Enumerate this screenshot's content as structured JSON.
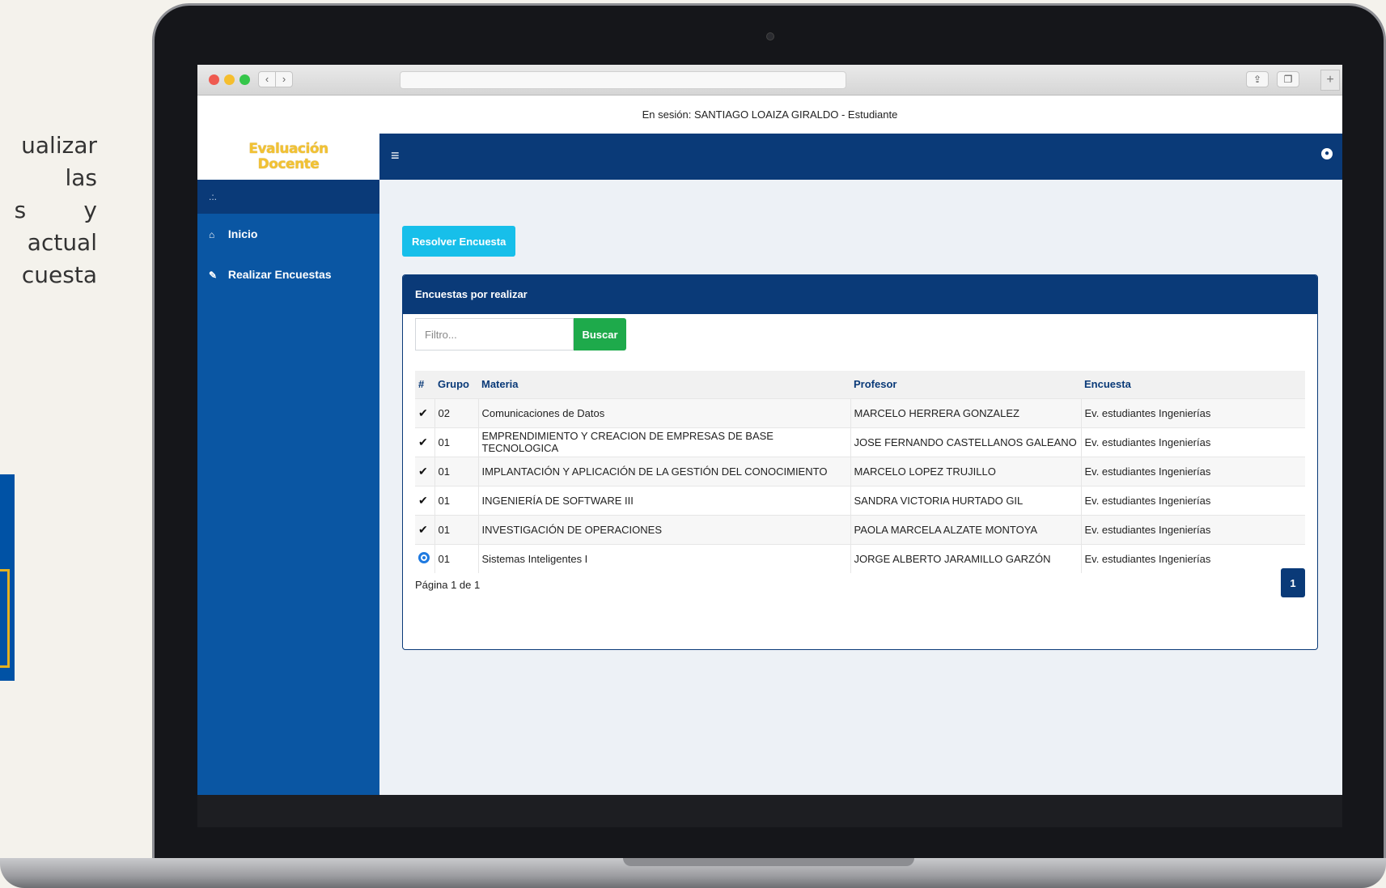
{
  "slide": {
    "lines": [
      "ualizar",
      "las",
      "s        y",
      "actual",
      "cuesta"
    ]
  },
  "session": {
    "text": "En sesión: SANTIAGO LOAIZA GIRALDO - Estudiante"
  },
  "brand": {
    "line1": "Evaluación",
    "line2": "Docente"
  },
  "sidebar": {
    "sub_label": ".:.",
    "items": [
      {
        "label": "Inicio",
        "icon": "home-icon"
      },
      {
        "label": "Realizar Encuestas",
        "icon": "pencil-icon"
      }
    ]
  },
  "content": {
    "resolve_label": "Resolver Encuesta",
    "panel_title": "Encuestas por realizar",
    "filter_placeholder": "Filtro...",
    "search_label": "Buscar",
    "columns": [
      "#",
      "Grupo",
      "Materia",
      "Profesor",
      "Encuesta"
    ],
    "rows": [
      {
        "status": "done",
        "grupo": "02",
        "materia": "Comunicaciones de Datos",
        "profesor": "MARCELO HERRERA GONZALEZ",
        "encuesta": "Ev. estudiantes Ingenierías"
      },
      {
        "status": "done",
        "grupo": "01",
        "materia": "EMPRENDIMIENTO Y CREACION DE EMPRESAS DE BASE TECNOLOGICA",
        "profesor": "JOSE FERNANDO CASTELLANOS GALEANO",
        "encuesta": "Ev. estudiantes Ingenierías"
      },
      {
        "status": "done",
        "grupo": "01",
        "materia": "IMPLANTACIÓN Y APLICACIÓN DE LA GESTIÓN DEL CONOCIMIENTO",
        "profesor": "MARCELO LOPEZ TRUJILLO",
        "encuesta": "Ev. estudiantes Ingenierías"
      },
      {
        "status": "done",
        "grupo": "01",
        "materia": "INGENIERÍA DE SOFTWARE III",
        "profesor": "SANDRA VICTORIA HURTADO GIL",
        "encuesta": "Ev. estudiantes Ingenierías"
      },
      {
        "status": "done",
        "grupo": "01",
        "materia": "INVESTIGACIÓN DE OPERACIONES",
        "profesor": "PAOLA MARCELA ALZATE MONTOYA",
        "encuesta": "Ev. estudiantes Ingenierías"
      },
      {
        "status": "selected",
        "grupo": "01",
        "materia": "Sistemas Inteligentes I",
        "profesor": "JORGE ALBERTO JARAMILLO GARZÓN",
        "encuesta": "Ev. estudiantes Ingenierías"
      }
    ],
    "page_info": "Página 1 de 1",
    "page_button": "1"
  },
  "colors": {
    "sidebar": "#0a56a3",
    "topbar": "#0a3a78",
    "resolve_button": "#17bfea",
    "search_button": "#1eaa4b",
    "brand": "#f2c233"
  }
}
